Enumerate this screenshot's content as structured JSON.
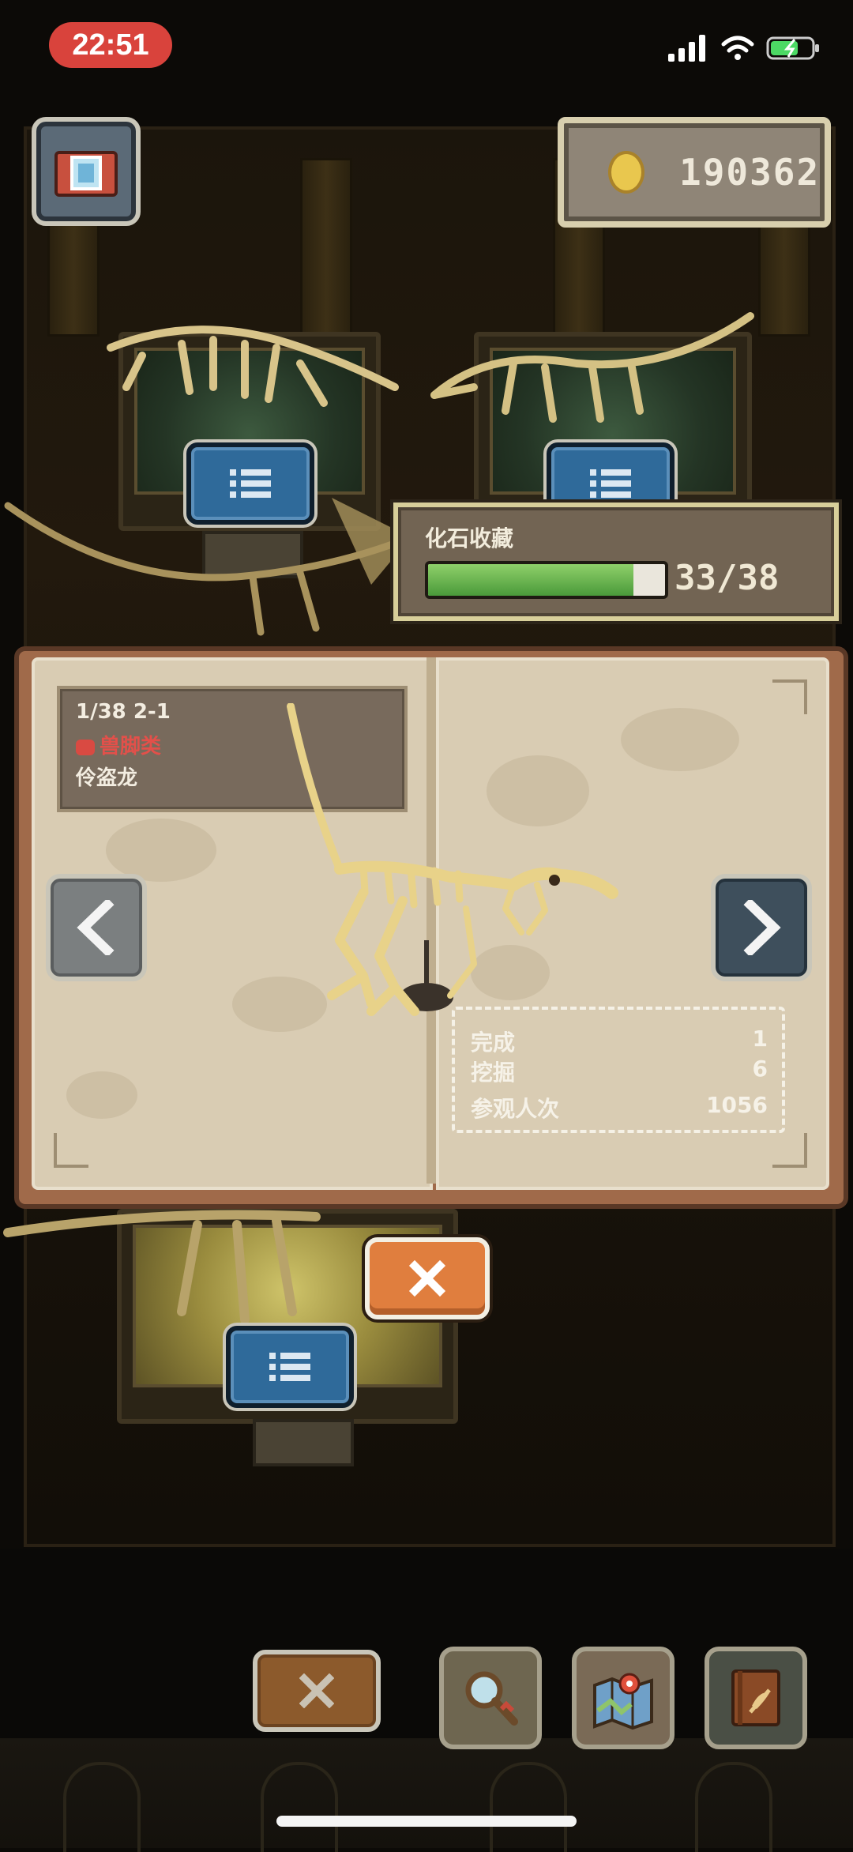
{
  "status_bar": {
    "time": "22:51"
  },
  "hud": {
    "coins": "190362"
  },
  "collection": {
    "title": "化石收藏",
    "count": "33/38",
    "progress": 0.868
  },
  "specimen": {
    "index": "1/38 2-1",
    "category": "兽脚类",
    "name": "伶盗龙"
  },
  "stats": [
    {
      "label": "完成",
      "value": "1"
    },
    {
      "label": "挖掘",
      "value": "6"
    },
    {
      "label": "参观人次",
      "value": "1056"
    }
  ],
  "colors": {
    "accent_orange": "#e07e3e",
    "progress_green": "#4a9a3a",
    "category_red": "#e3504a",
    "info_blue": "#2f6a9a"
  },
  "icons": {
    "camera": "camera-icon",
    "coin": "coin-icon",
    "prev": "chevron-left-icon",
    "next": "chevron-right-icon",
    "close": "close-icon",
    "search": "magnifier-icon",
    "map": "map-icon",
    "book": "fossil-book-icon"
  }
}
